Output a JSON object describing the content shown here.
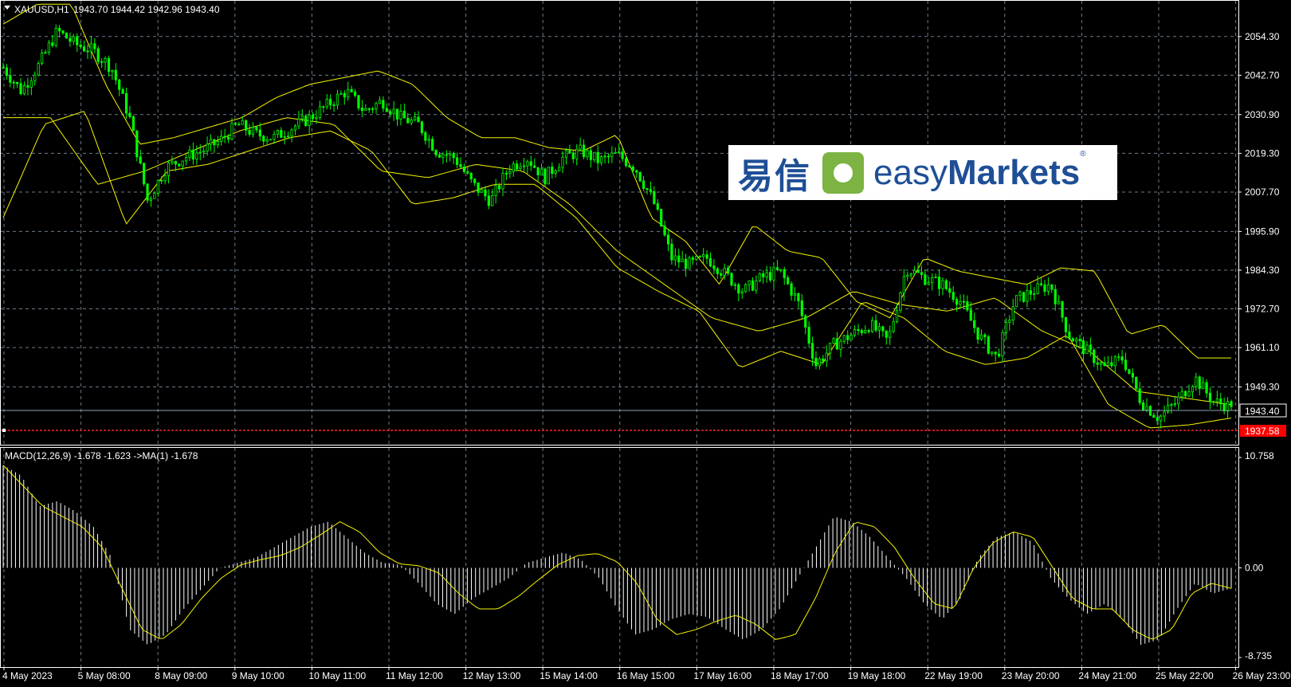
{
  "header": {
    "symbol": "XAUUSD,H1",
    "ohlc": "1943.70 1944.42 1942.96 1943.40"
  },
  "macd_header": "MACD(12,26,9) -1.678 -1.623  ->MA(1) -1.678",
  "logo": {
    "cn": "易信",
    "en_light": "easy",
    "en_bold": "Markets",
    "reg": "®"
  },
  "colors": {
    "background": "#000000",
    "grid": "#6d7b8a",
    "candle": "#00ff00",
    "bands": "#f5f500",
    "histogram": "#ffffff",
    "signal": "#f5f500",
    "bid_line": "#8aa0b4",
    "stop_line": "#ff2020"
  },
  "chart_data": [
    {
      "type": "candlestick",
      "symbol": "XAUUSD",
      "timeframe": "H1",
      "ylim": [
        1932.0,
        2065.0
      ],
      "y_ticks": [
        "2054.30",
        "2042.70",
        "2030.90",
        "2019.30",
        "2007.70",
        "1995.90",
        "1984.30",
        "1972.70",
        "1961.10",
        "1949.30"
      ],
      "current_price": "1943.40",
      "marked_level": "1937.58",
      "x_ticks": [
        "4 May 2023",
        "5 May 08:00",
        "8 May 09:00",
        "9 May 10:00",
        "10 May 11:00",
        "11 May 12:00",
        "12 May 13:00",
        "15 May 14:00",
        "16 May 15:00",
        "17 May 16:00",
        "18 May 17:00",
        "19 May 18:00",
        "22 May 19:00",
        "23 May 20:00",
        "24 May 21:00",
        "25 May 22:00",
        "26 May 23:00"
      ],
      "close_path": [
        2045,
        2038,
        2046,
        2056,
        2052,
        2050,
        2045,
        2030,
        2005,
        2015,
        2018,
        2020,
        2023,
        2028,
        2025,
        2024,
        2027,
        2030,
        2034,
        2038,
        2032,
        2035,
        2030,
        2028,
        2020,
        2018,
        2010,
        2005,
        2015,
        2018,
        2012,
        2018,
        2020,
        2017,
        2019,
        2015,
        2005,
        1988,
        1986,
        1988,
        1983,
        1978,
        1982,
        1984,
        1975,
        1956,
        1962,
        1965,
        1968,
        1963,
        1985,
        1982,
        1980,
        1975,
        1965,
        1958,
        1975,
        1978,
        1980,
        1965,
        1960,
        1955,
        1958,
        1945,
        1940,
        1945,
        1952,
        1945,
        1943.4
      ],
      "bb_upper": [
        2058,
        2064,
        2064,
        2040,
        2022,
        2024,
        2027,
        2030,
        2036,
        2040,
        2042,
        2044,
        2040,
        2030,
        2024,
        2024,
        2021,
        2020,
        2025,
        2000,
        1993,
        1980,
        1998,
        1990,
        1988,
        1975,
        1970,
        1988,
        1984,
        1982,
        1980,
        1985,
        1984,
        1965,
        1968,
        1958,
        1958
      ],
      "bb_lower": [
        2000,
        2028,
        2032,
        1998,
        2014,
        2016,
        2020,
        2024,
        2026,
        2020,
        2004,
        2006,
        2010,
        2010,
        2000,
        1985,
        1978,
        1972,
        1955,
        1960,
        1956,
        1975,
        1970,
        1960,
        1956,
        1958,
        1965,
        1944,
        1937,
        1938,
        1940
      ],
      "bb_middle": [
        2030,
        2030,
        2010,
        2014,
        2020,
        2026,
        2030,
        2028,
        2014,
        2012,
        2016,
        2014,
        2004,
        1990,
        1980,
        1970,
        1966,
        1970,
        1978,
        1974,
        1972,
        1976,
        1966,
        1960,
        1948,
        1946,
        1944
      ]
    },
    {
      "type": "histogram+line",
      "name": "MACD(12,26,9)",
      "ylim": [
        -8.735,
        10.758
      ],
      "y_ticks": [
        "10.758",
        "0.00",
        "-8.735"
      ],
      "histogram": [
        10.0,
        9.0,
        6.0,
        6.5,
        5.5,
        4.0,
        1.0,
        -6.0,
        -7.5,
        -6.5,
        -4.0,
        -2.0,
        0.0,
        0.5,
        1.0,
        2.0,
        3.0,
        4.0,
        4.5,
        3.0,
        1.5,
        0.5,
        0.3,
        -1.5,
        -3.5,
        -4.5,
        -3.0,
        -2.0,
        -1.0,
        0.5,
        1.0,
        1.5,
        0.8,
        -1.0,
        -4.0,
        -6.5,
        -6.0,
        -5.0,
        -4.5,
        -4.8,
        -6.0,
        -7.0,
        -6.0,
        -4.0,
        -1.0,
        2.0,
        5.0,
        4.5,
        3.0,
        1.0,
        -1.0,
        -3.5,
        -5.0,
        -3.0,
        1.0,
        3.0,
        3.5,
        2.5,
        -1.0,
        -3.0,
        -4.5,
        -3.5,
        -5.0,
        -7.5,
        -7.0,
        -4.0,
        -1.5,
        -2.5,
        -2.0
      ],
      "signal": [
        10.0,
        8.0,
        6.0,
        5.0,
        4.0,
        2.0,
        -2.0,
        -6.0,
        -7.0,
        -5.5,
        -3.0,
        -1.0,
        0.3,
        0.8,
        1.2,
        2.0,
        3.2,
        4.5,
        3.5,
        1.5,
        0.4,
        0.2,
        -0.5,
        -2.5,
        -4.0,
        -4.0,
        -2.8,
        -1.2,
        0.3,
        1.2,
        1.4,
        0.6,
        -1.5,
        -5.0,
        -6.5,
        -6.0,
        -5.2,
        -4.6,
        -5.5,
        -7.0,
        -6.5,
        -3.0,
        1.5,
        4.5,
        4.0,
        2.0,
        -1.0,
        -3.5,
        -4.0,
        0.0,
        2.5,
        3.5,
        3.0,
        0.0,
        -3.0,
        -4.0,
        -4.0,
        -6.0,
        -7.0,
        -6.0,
        -2.5,
        -1.5,
        -2.0
      ]
    }
  ]
}
